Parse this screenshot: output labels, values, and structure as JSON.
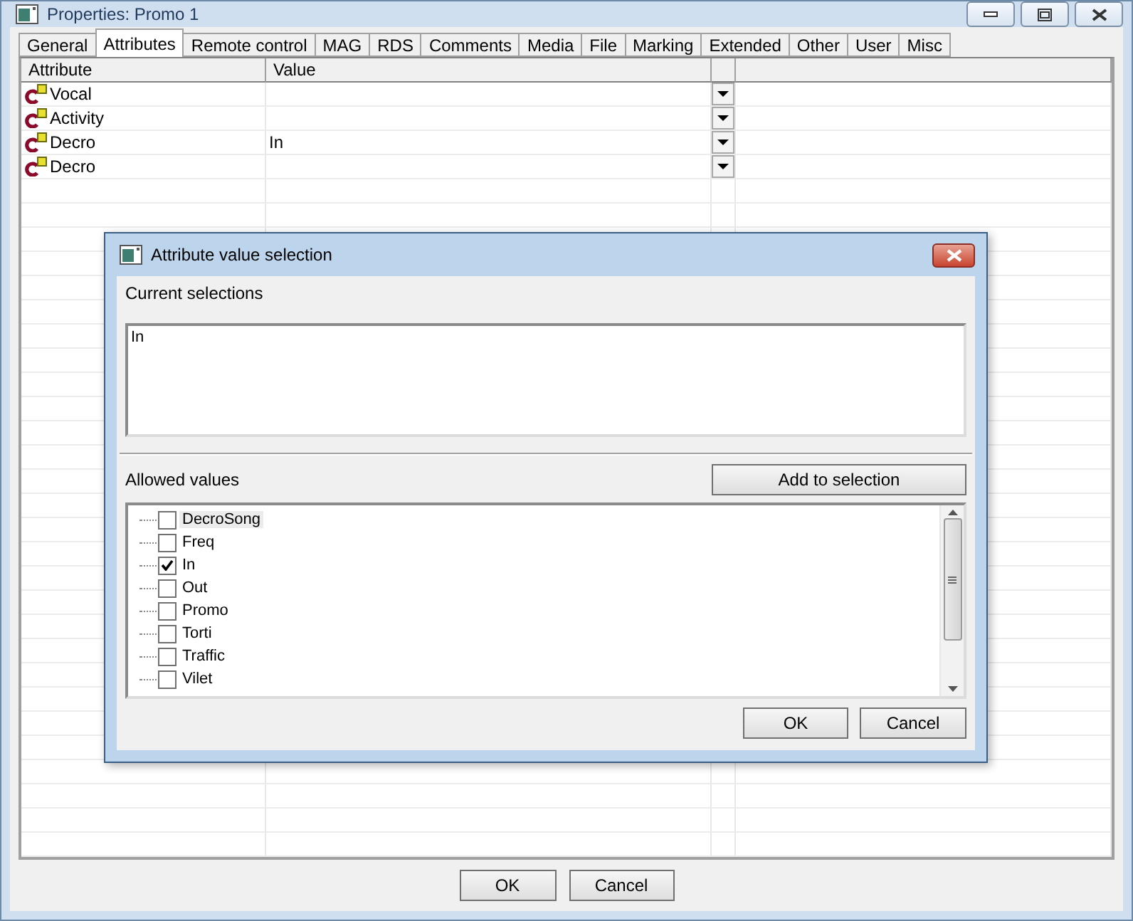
{
  "window": {
    "title": "Properties: Promo  1"
  },
  "tabs": [
    {
      "label": "General",
      "selected": false
    },
    {
      "label": "Attributes",
      "selected": true
    },
    {
      "label": "Remote control",
      "selected": false
    },
    {
      "label": "MAG",
      "selected": false
    },
    {
      "label": "RDS",
      "selected": false
    },
    {
      "label": "Comments",
      "selected": false
    },
    {
      "label": "Media",
      "selected": false
    },
    {
      "label": "File",
      "selected": false
    },
    {
      "label": "Marking",
      "selected": false
    },
    {
      "label": "Extended",
      "selected": false
    },
    {
      "label": "Other",
      "selected": false
    },
    {
      "label": "User",
      "selected": false
    },
    {
      "label": "Misc",
      "selected": false
    }
  ],
  "grid": {
    "columns": [
      "Attribute",
      "Value"
    ],
    "rows": [
      {
        "attribute": "Vocal"
      },
      {
        "attribute": "Activity"
      },
      {
        "attribute": "Decro",
        "value": "In"
      },
      {
        "attribute": "Decro"
      }
    ]
  },
  "dialog": {
    "title": "Attribute value selection",
    "current_label": "Current selections",
    "current_value": "In",
    "allowed_label": "Allowed values",
    "add_button": "Add to selection",
    "allowed_values": [
      {
        "label": "DecroSong",
        "checked": false,
        "selected": true
      },
      {
        "label": "Freq",
        "checked": false,
        "selected": false
      },
      {
        "label": "In",
        "checked": true,
        "selected": false
      },
      {
        "label": "Out",
        "checked": false,
        "selected": false
      },
      {
        "label": "Promo",
        "checked": false,
        "selected": false
      },
      {
        "label": "Torti",
        "checked": false,
        "selected": false
      },
      {
        "label": "Traffic",
        "checked": false,
        "selected": false
      },
      {
        "label": "Vilet",
        "checked": false,
        "selected": false
      }
    ],
    "buttons": [
      "OK",
      "Cancel"
    ]
  },
  "buttons": [
    "OK",
    "Cancel"
  ]
}
